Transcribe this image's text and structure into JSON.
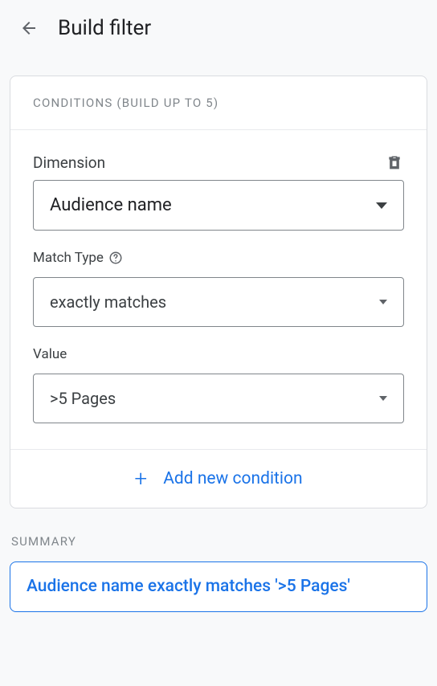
{
  "header": {
    "title": "Build filter"
  },
  "conditions": {
    "section_title": "CONDITIONS (BUILD UP TO 5)",
    "dimension": {
      "label": "Dimension",
      "value": "Audience name"
    },
    "match_type": {
      "label": "Match Type",
      "value": "exactly matches"
    },
    "value_field": {
      "label": "Value",
      "value": ">5 Pages"
    },
    "add_new_label": "Add new condition"
  },
  "summary": {
    "title": "SUMMARY",
    "text": "Audience name exactly matches '>5 Pages'"
  }
}
